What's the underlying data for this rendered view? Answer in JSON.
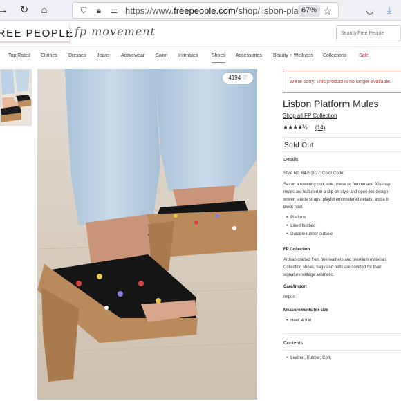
{
  "browser": {
    "url_prefix": "https://www.",
    "url_domain": "freepeople.com",
    "url_path": "/shop/lisbon-platf",
    "zoom": "67%"
  },
  "site": {
    "logo": "FREE PEOPLE",
    "movement": "fp movement",
    "search_placeholder": "Search Free People"
  },
  "nav": {
    "items": [
      "Top Rated",
      "Clothes",
      "Dresses",
      "Jeans",
      "Activewear",
      "Swim",
      "Intimates",
      "Shoes",
      "Accessories",
      "Beauty + Wellness",
      "Collections",
      "Sale"
    ],
    "active": "Shoes"
  },
  "product": {
    "likes": "4194",
    "alert": "We're sorry. This product is no longer available.",
    "title": "Lisbon Platform Mules",
    "collection_link": "Shop all FP Collection",
    "rating_stars": "★★★★½",
    "review_count": "(14)",
    "status": "Sold Out",
    "details_heading": "Details",
    "style_no": "Style No. 64751027; Color Code:",
    "description_lines": [
      "Set on a towering cork sole, these so femme and 90s-insp",
      "mules are featured in a slip-on style and open-toe design",
      "woven suede straps, playful embroidered details, and a b",
      "block heel."
    ],
    "features": [
      "Platform",
      "Lined footbed",
      "Durable rubber outsole"
    ],
    "fp_collection_heading": "FP Collection",
    "fp_collection_lines": [
      "Artisan crafted from fine leathers and premium materials",
      "Collection shoes, bags and belts are coveted for their",
      "signature vintage aesthetic."
    ],
    "care_heading": "Care/Import",
    "care_value": "Import",
    "measurements_heading": "Measurements for size",
    "measurement": "Heel: 4.9 in",
    "contents_heading": "Contents",
    "contents_value": "Leather, Rubber, Cork"
  },
  "colors": {
    "sale": "#c2185b",
    "alert": "#c0392b",
    "cork": "#b98a5c",
    "denim": "#bcd1e3"
  }
}
